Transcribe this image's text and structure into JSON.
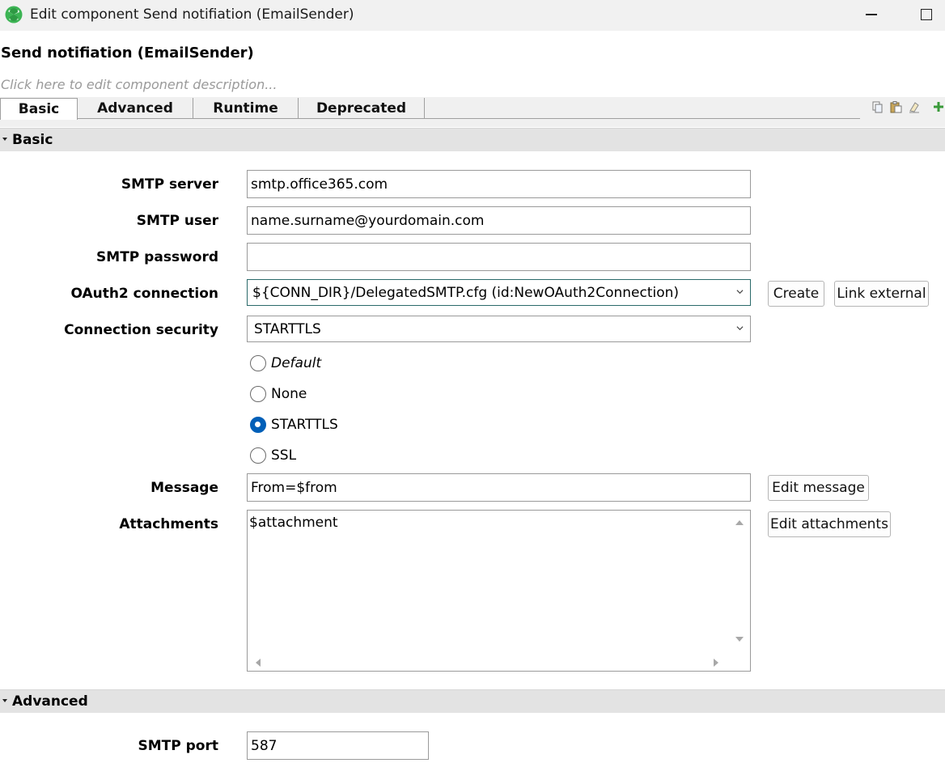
{
  "window": {
    "title": "Edit component Send notifiation (EmailSender)",
    "app_icon": "clover-icon",
    "controls": [
      "minimize-icon",
      "maximize-icon"
    ]
  },
  "component": {
    "title": "Send notifiation (EmailSender)",
    "description_placeholder": "Click here to edit component description..."
  },
  "tabs": [
    {
      "label": "Basic",
      "active": true
    },
    {
      "label": "Advanced",
      "active": false
    },
    {
      "label": "Runtime",
      "active": false
    },
    {
      "label": "Deprecated",
      "active": false
    }
  ],
  "toolbar_icons": [
    "copy-icon",
    "paste-icon",
    "clear-icon",
    "add-icon"
  ],
  "sections": {
    "basic": {
      "title": "Basic",
      "fields": {
        "smtp_server": {
          "label": "SMTP server",
          "value": "smtp.office365.com"
        },
        "smtp_user": {
          "label": "SMTP user",
          "value": "name.surname@yourdomain.com"
        },
        "smtp_password": {
          "label": "SMTP password",
          "value": ""
        },
        "oauth2_connection": {
          "label": "OAuth2 connection",
          "value": "${CONN_DIR}/DelegatedSMTP.cfg (id:NewOAuth2Connection)",
          "create_label": "Create",
          "link_label": "Link external"
        },
        "connection_security": {
          "label": "Connection security",
          "value": "STARTTLS",
          "options": [
            {
              "label": "Default",
              "checked": false
            },
            {
              "label": "None",
              "checked": false
            },
            {
              "label": "STARTTLS",
              "checked": true
            },
            {
              "label": "SSL",
              "checked": false
            }
          ]
        },
        "message": {
          "label": "Message",
          "value": "From=$from",
          "edit_label": "Edit message"
        },
        "attachments": {
          "label": "Attachments",
          "value": "$attachment",
          "edit_label": "Edit attachments"
        }
      }
    },
    "advanced": {
      "title": "Advanced",
      "fields": {
        "smtp_port": {
          "label": "SMTP port",
          "value": "587"
        }
      }
    }
  },
  "colors": {
    "accent": "#005fb8",
    "logo_green": "#3cb454",
    "section_bg": "#e3e3e3",
    "titlebar_bg": "#f1f1f1"
  }
}
